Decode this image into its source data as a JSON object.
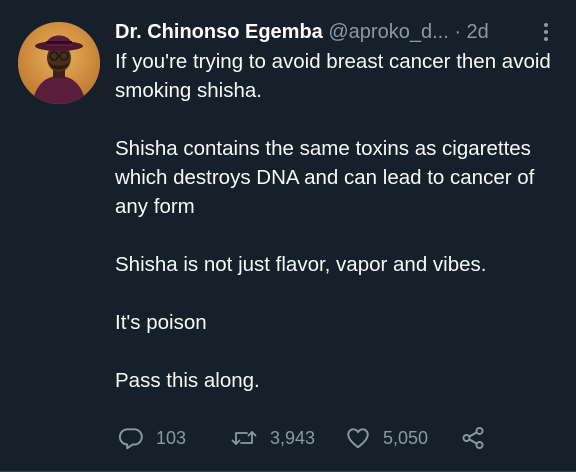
{
  "tweet": {
    "author": {
      "name": "Dr. Chinonso Egemba",
      "handle": "@aproko_d...",
      "separator": "·",
      "time": "2d"
    },
    "paragraphs": [
      "If you're trying to avoid breast cancer then avoid smoking shisha.",
      "Shisha contains the same toxins as cigarettes which destroys DNA and can lead to cancer of any form",
      "Shisha is not just flavor, vapor and vibes.",
      "It's poison",
      "Pass this along."
    ],
    "actions": {
      "replies": "103",
      "retweets": "3,943",
      "likes": "5,050"
    }
  },
  "icons": {
    "more": "more-vertical-icon",
    "reply": "reply-icon",
    "retweet": "retweet-icon",
    "like": "heart-icon",
    "share": "share-icon"
  },
  "colors": {
    "background": "#15202b",
    "text": "#f7f9f9",
    "secondary": "#8b98a5"
  }
}
